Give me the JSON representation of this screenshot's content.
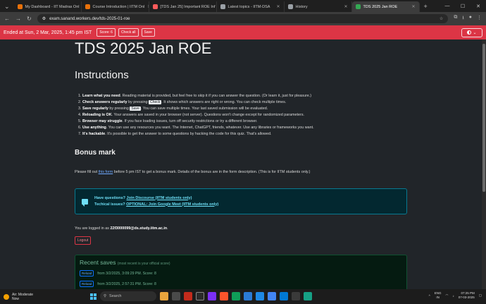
{
  "browser": {
    "tabs": [
      {
        "title": "My Dashboard - IIT Madras Onl",
        "color": "#e8710a",
        "active": false
      },
      {
        "title": "Course Introduction | IITM Onl",
        "color": "#e8710a",
        "active": false
      },
      {
        "title": "[TDS Jan 25] Important ROE Inf",
        "color": "#ff5b5b",
        "active": false
      },
      {
        "title": "Latest topics - IITM-DSA",
        "color": "#9aa0a6",
        "active": false
      },
      {
        "title": "History",
        "color": "#9aa0a6",
        "active": false
      },
      {
        "title": "TDS 2025 Jan ROE",
        "color": "#34a853",
        "active": true
      }
    ],
    "url": "exam.sanand.workers.dev/tds-2025-01-roe"
  },
  "header": {
    "ended": "Ended at Sun, 2 Mar, 2025, 1:45 pm IST",
    "score_label": "Score: 6",
    "check_all_label": "Check all",
    "save_label": "Save"
  },
  "page": {
    "title": "TDS 2025 Jan ROE",
    "instructions_heading": "Instructions",
    "rules": [
      {
        "bold": "Learn what you need",
        "text": ". Reading material is provided, but feel free to skip it if you can answer the question. (Or learn it, just for pleasure.)"
      },
      {
        "bold": "Check answers regularly",
        "text": " by pressing ",
        "kbd": "Check",
        "text2": ". It shows which answers are right or wrong. You can check multiple times."
      },
      {
        "bold": "Save regularly",
        "text": " by pressing ",
        "kbd": "Save",
        "text2": ". You can save multiple times. Your last saved submission will be evaluated."
      },
      {
        "bold": "Reloading is OK",
        "text": ". Your answers are saved in your browser (not server). Questions won't change except for randomized parameters."
      },
      {
        "bold": "Browser may struggle",
        "text": ". If you face loading issues, turn off security restrictions or try a different browser."
      },
      {
        "bold": "Use anything",
        "text": ". You can use any resources you want. The Internet, ChatGPT, friends, whatever. Use any libraries or frameworks you want."
      },
      {
        "bold": "It's hackable",
        "text": ". It's possible to get the answer to some questions by hacking the code for this quiz. That's allowed."
      }
    ],
    "bonus_heading": "Bonus mark",
    "bonus_pre": "Please fill out ",
    "bonus_link": "this form",
    "bonus_post": " before 5 pm IST to get a bonus mark. Details of the bonus are in the form description. (This is for IITM students only.)",
    "info_q_label": "Have questions? ",
    "info_q_link": "Join Discourse (IITM students only)",
    "info_t_label": "Techical issues? ",
    "info_t_link": "OPTIONAL: Join Google Meet (IITM students only)",
    "logged_pre": "You are logged in as ",
    "logged_email": "22f3000099@ds.study.iitm.ac.in",
    "logged_post": ".",
    "logout_label": "Logout",
    "saves_heading": "Recent saves",
    "saves_note": "(most recent is your official score)",
    "saves": [
      {
        "reload": "Reload",
        "text": "from 3/2/2025, 3:09:29 PM. Score: 8"
      },
      {
        "reload": "Reload",
        "text": "from 3/2/2025, 2:57:31 PM. Score: 8"
      }
    ]
  },
  "taskbar": {
    "weather_label": "Air: Moderate",
    "weather_sub": "Now",
    "search_placeholder": "Search",
    "lang1": "ENG",
    "lang2": "IN",
    "time": "07:25 PM",
    "date": "07-03-2025"
  }
}
